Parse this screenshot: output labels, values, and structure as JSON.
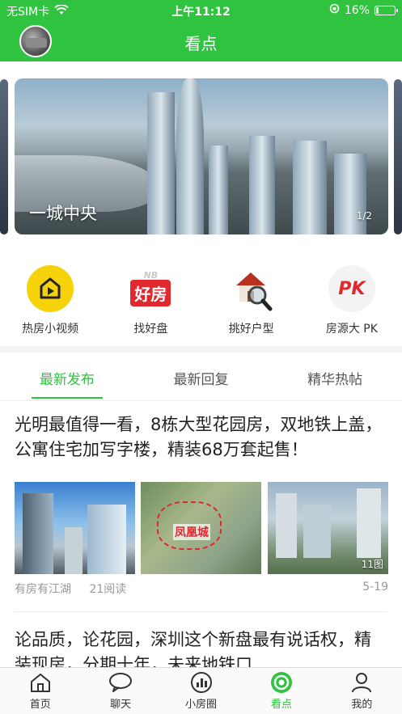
{
  "status_bar": {
    "carrier": "无SIM卡",
    "time": "上午11:12",
    "battery_text": "16%",
    "battery_level": 0.16
  },
  "header": {
    "title": "看点"
  },
  "banner": {
    "caption": "一城中央",
    "counter": "1/2"
  },
  "quick_nav": [
    {
      "label": "热房小视频",
      "icon": "video-play-icon"
    },
    {
      "label": "找好盘",
      "icon": "nb-haofang-logo",
      "logo_text": "好房",
      "logo_prefix": "NB"
    },
    {
      "label": "挑好户型",
      "icon": "house-magnifier-icon"
    },
    {
      "label": "房源大 PK",
      "icon": "pk-icon",
      "logo_text": "PK"
    }
  ],
  "tabs": [
    {
      "label": "最新发布",
      "active": true
    },
    {
      "label": "最新回复",
      "active": false
    },
    {
      "label": "精华热帖",
      "active": false
    }
  ],
  "posts": [
    {
      "title": "光明最值得一看，8栋大型花园房，双地铁上盖，公寓住宅加写字楼，精装68万套起售！",
      "author": "有房有江湖",
      "reads": "21阅读",
      "date": "5-19",
      "image_count": "11图",
      "map_label": "凤凰城"
    },
    {
      "title": "论品质，论花园，深圳这个新盘最有说话权，精装现房，分期十年，未来地铁口"
    }
  ],
  "tab_bar": [
    {
      "label": "首页",
      "icon": "home-icon",
      "active": false
    },
    {
      "label": "聊天",
      "icon": "chat-bubble-icon",
      "active": false
    },
    {
      "label": "小房圈",
      "icon": "bar-chart-icon",
      "active": false
    },
    {
      "label": "看点",
      "icon": "target-icon",
      "active": true
    },
    {
      "label": "我的",
      "icon": "person-icon",
      "active": false
    }
  ],
  "colors": {
    "brand_green": "#2fc33f",
    "text": "#222222",
    "muted": "#999999"
  }
}
